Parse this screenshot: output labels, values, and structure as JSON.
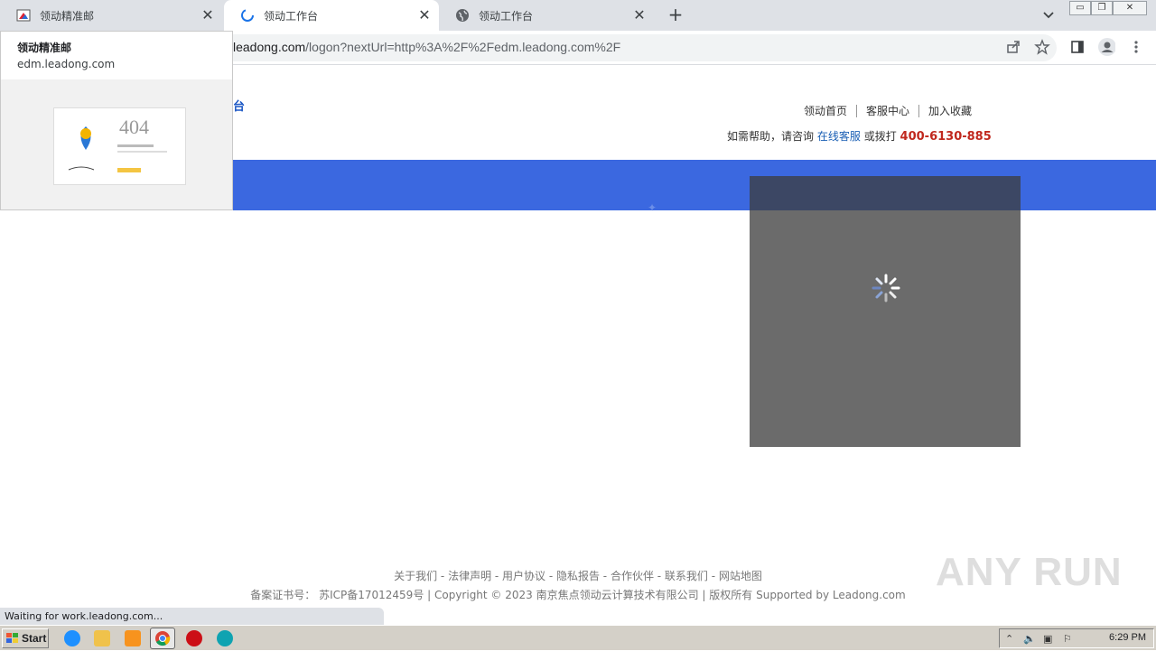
{
  "tabs": [
    {
      "title": "领动精准邮",
      "icon": "leadong-edm-favicon"
    },
    {
      "title": "领动工作台",
      "icon": "loading-spinner-icon"
    },
    {
      "title": "领动工作台",
      "icon": "globe-icon"
    }
  ],
  "address_bar": {
    "host_visible": "leadong.com",
    "path": "/logon?nextUrl=http%3A%2F%2Fedm.leadong.com%2F"
  },
  "hover_card": {
    "title": "领动精准邮",
    "url": "edm.leadong.com",
    "thumbnail_404": "404"
  },
  "page": {
    "logo_fragment": "台",
    "nav": [
      "领动首页",
      "客服中心",
      "加入收藏"
    ],
    "help_prefix": "如需帮助，请咨询",
    "help_link": "在线客服",
    "help_mid": "或拨打",
    "phone": "400-6130-885",
    "banner_color": "#3b68e0",
    "footer_links": "关于我们 - 法律声明 - 用户协议 - 隐私报告 - 合作伙伴 - 联系我们 - 网站地图",
    "footer_copy": "备案证书号： 苏ICP备17012459号 | Copyright © 2023 南京焦点领动云计算技术有限公司 | 版权所有 Supported by Leadong.com"
  },
  "status": "Waiting for work.leadong.com...",
  "watermark": "ANY RUN",
  "taskbar": {
    "start_label": "Start",
    "clock": "6:29 PM"
  }
}
